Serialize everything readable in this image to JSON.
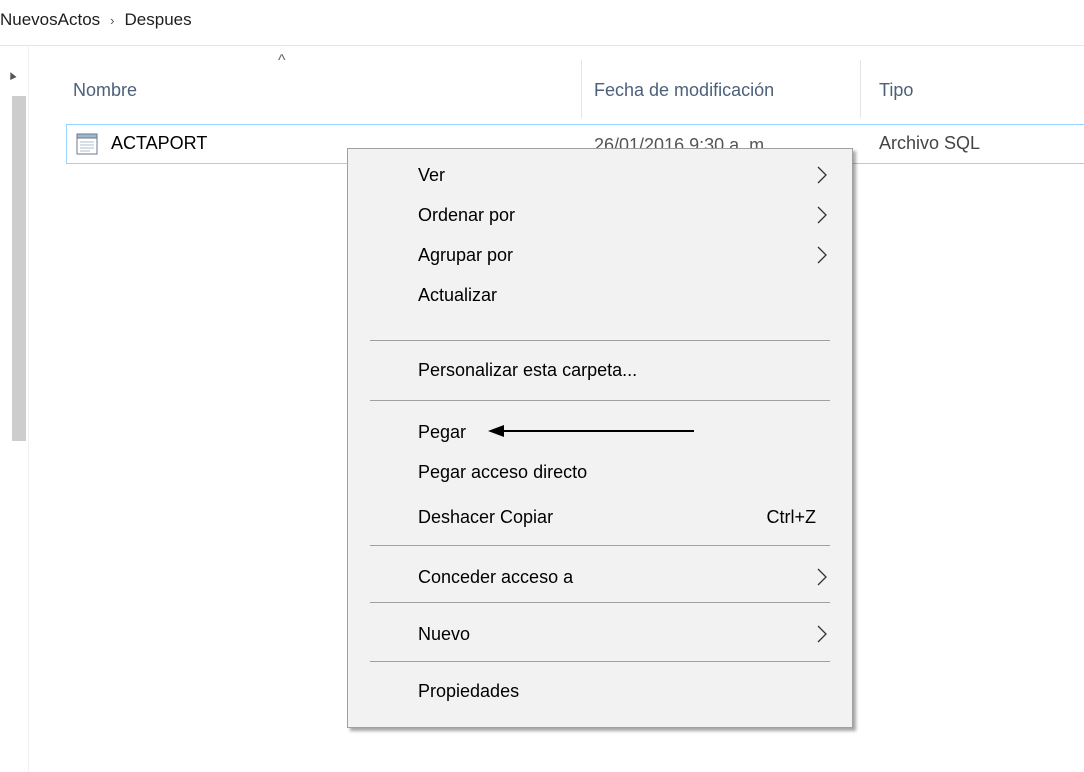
{
  "breadcrumb": {
    "items": [
      "NuevosActos",
      "Despues"
    ],
    "separator": "›"
  },
  "columns": {
    "name": "Nombre",
    "date": "Fecha de modificación",
    "type": "Tipo",
    "sort_indicator": "^"
  },
  "files": [
    {
      "name": "ACTAPORT",
      "date": "26/01/2016 9:30 a. m.",
      "type": "Archivo SQL",
      "icon": "sql-file-icon"
    }
  ],
  "context_menu": {
    "ver": "Ver",
    "ordenar": "Ordenar por",
    "agrupar": "Agrupar por",
    "actualizar": "Actualizar",
    "personalizar": "Personalizar esta carpeta...",
    "pegar": "Pegar",
    "pegar_acceso": "Pegar acceso directo",
    "deshacer": "Deshacer Copiar",
    "deshacer_shortcut": "Ctrl+Z",
    "conceder": "Conceder acceso a",
    "nuevo": "Nuevo",
    "propiedades": "Propiedades"
  },
  "colors": {
    "selection_border": "#99d1ff",
    "menu_bg": "#f2f2f2",
    "header_text": "#4c607a"
  }
}
